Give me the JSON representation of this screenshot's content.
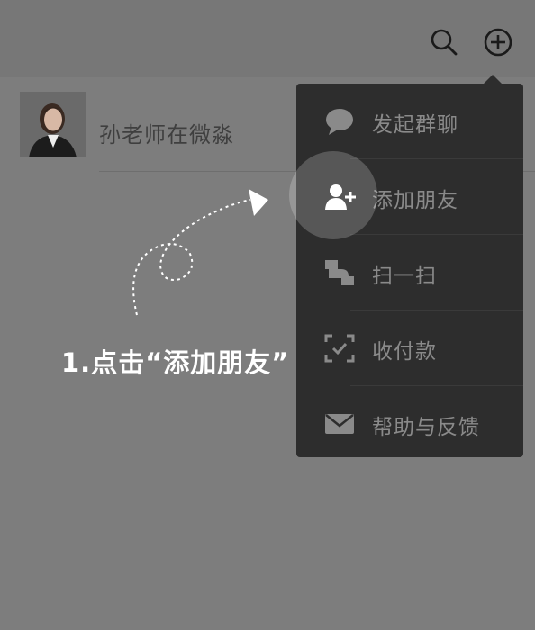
{
  "header": {
    "icons": [
      "search-icon",
      "plus-circle-icon"
    ]
  },
  "chat_list": {
    "items": [
      {
        "name": "孙老师在微淼",
        "avatar": "profile-photo"
      }
    ]
  },
  "popup_menu": {
    "items": [
      {
        "label": "发起群聊",
        "icon": "chat-bubble-icon"
      },
      {
        "label": "添加朋友",
        "icon": "add-friend-icon"
      },
      {
        "label": "扫一扫",
        "icon": "scan-icon"
      },
      {
        "label": "收付款",
        "icon": "payment-icon"
      },
      {
        "label": "帮助与反馈",
        "icon": "mail-icon"
      }
    ]
  },
  "annotation": {
    "step_text": "1.点击“添加朋友”"
  },
  "colors": {
    "overlay": "#7d7d7d",
    "menu_bg": "#2d2d2d",
    "menu_text": "#8a8a8a",
    "annotation_text": "#ffffff"
  }
}
